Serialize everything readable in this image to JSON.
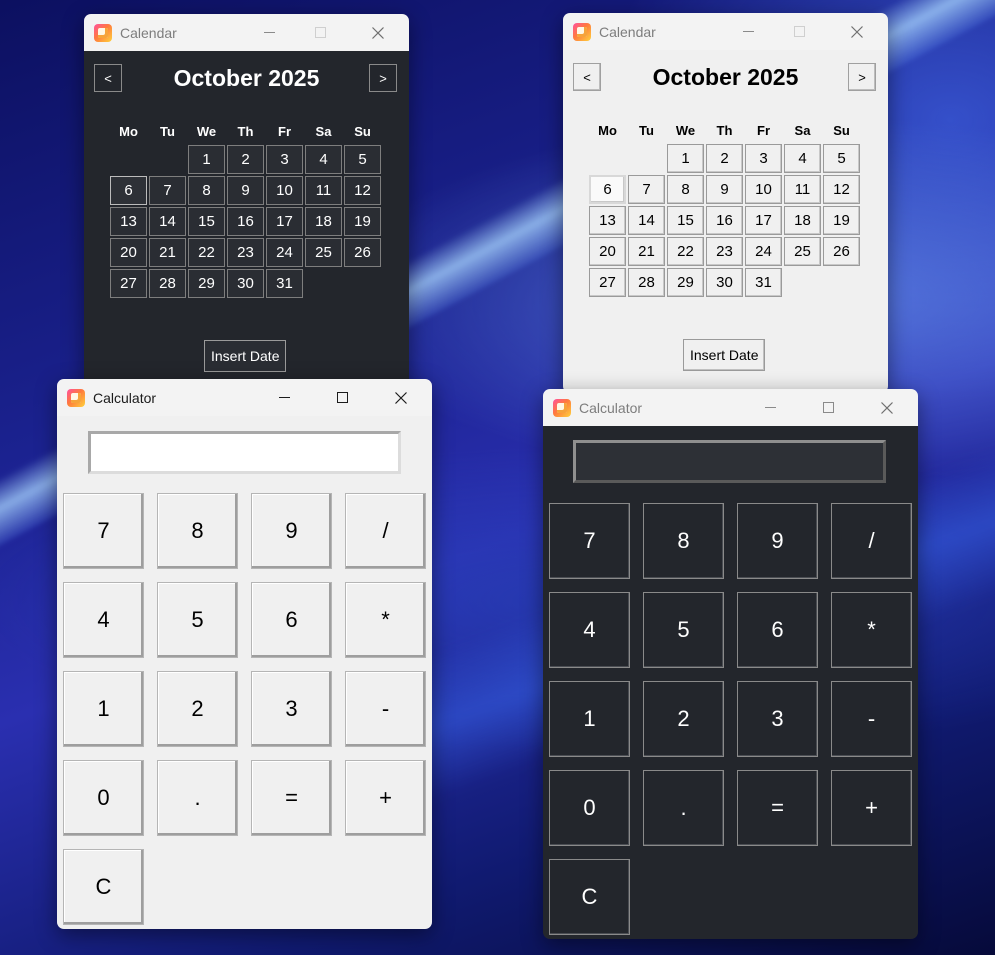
{
  "windows": {
    "calendar_dark": {
      "title": "Calendar"
    },
    "calendar_light": {
      "title": "Calendar"
    },
    "calculator_light": {
      "title": "Calculator"
    },
    "calculator_dark": {
      "title": "Calculator"
    }
  },
  "calendar": {
    "prev_label": "<",
    "next_label": ">",
    "month_title": "October 2025",
    "weekdays": [
      "Mo",
      "Tu",
      "We",
      "Th",
      "Fr",
      "Sa",
      "Su"
    ],
    "days": [
      "1",
      "2",
      "3",
      "4",
      "5",
      "6",
      "7",
      "8",
      "9",
      "10",
      "11",
      "12",
      "13",
      "14",
      "15",
      "16",
      "17",
      "18",
      "19",
      "20",
      "21",
      "22",
      "23",
      "24",
      "25",
      "26",
      "27",
      "28",
      "29",
      "30",
      "31"
    ],
    "first_weekday_index": 2,
    "selected_day": "6",
    "insert_label": "Insert Date"
  },
  "calculator": {
    "display_value": "",
    "keys": [
      "7",
      "8",
      "9",
      "/",
      "4",
      "5",
      "6",
      "*",
      "1",
      "2",
      "3",
      "-",
      "0",
      ".",
      "=",
      "+",
      "C"
    ]
  },
  "icons": {
    "app_icon": "notepad-app-icon",
    "minimize": "minimize-icon",
    "maximize": "maximize-icon",
    "close": "close-icon"
  },
  "colors": {
    "dark_bg": "#23262c",
    "light_bg": "#f0f0f0",
    "desktop_accent": "#2a2fb0"
  }
}
